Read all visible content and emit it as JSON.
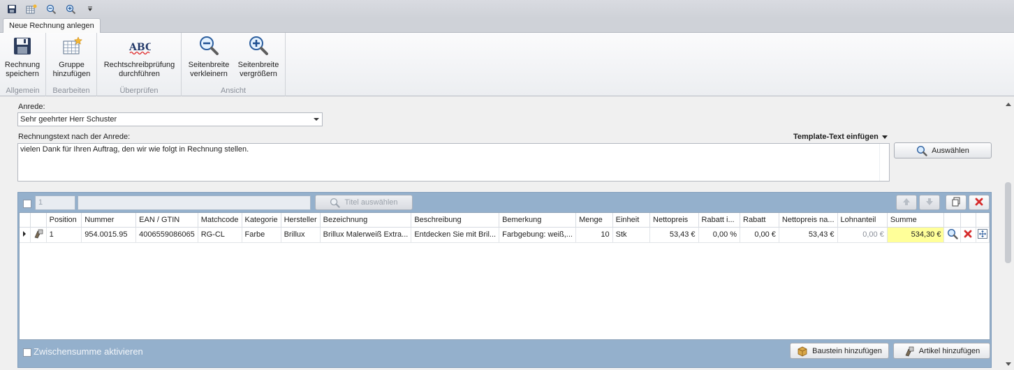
{
  "ribbon": {
    "tab": "Neue Rechnung anlegen",
    "groups": [
      {
        "label": "Allgemein",
        "buttons": [
          {
            "line1": "Rechnung",
            "line2": "speichern",
            "icon": "floppy-disk-icon"
          }
        ]
      },
      {
        "label": "Bearbeiten",
        "buttons": [
          {
            "line1": "Gruppe",
            "line2": "hinzufügen",
            "icon": "table-star-icon"
          }
        ]
      },
      {
        "label": "Überprüfen",
        "buttons": [
          {
            "line1": "Rechtschreibprüfung",
            "line2": "durchführen",
            "icon": "spellcheck-icon"
          }
        ]
      },
      {
        "label": "Ansicht",
        "buttons": [
          {
            "line1": "Seitenbreite",
            "line2": "verkleinern",
            "icon": "zoom-out-icon"
          },
          {
            "line1": "Seitenbreite",
            "line2": "vergrößern",
            "icon": "zoom-in-icon"
          }
        ]
      }
    ]
  },
  "form": {
    "salutation_label": "Anrede:",
    "salutation_value": "Sehr geehrter Herr Schuster",
    "text_label": "Rechnungstext nach der Anrede:",
    "template_link": "Template-Text einfügen",
    "text_value": "vielen Dank für Ihren Auftrag, den wir wie folgt in Rechnung stellen.",
    "select_button": "Auswählen"
  },
  "panel": {
    "position_input": "1",
    "title_button": "Titel auswählen",
    "subtotal_label": "Zwischensumme aktivieren",
    "add_block_button": "Baustein hinzufügen",
    "add_article_button": "Artikel hinzufügen"
  },
  "grid": {
    "columns": [
      "Position",
      "Nummer",
      "EAN / GTIN",
      "Matchcode",
      "Kategorie",
      "Hersteller",
      "Bezeichnung",
      "Beschreibung",
      "Bemerkung",
      "Menge",
      "Einheit",
      "Nettopreis",
      "Rabatt i...",
      "Rabatt",
      "Nettopreis na...",
      "Lohnanteil",
      "Summe"
    ],
    "rows": [
      {
        "position": "1",
        "nummer": "954.0015.95",
        "ean": "4006559086065",
        "matchcode": "RG-CL",
        "kategorie": "Farbe",
        "hersteller": "Brillux",
        "bezeichnung": "Brillux Malerweiß Extra...",
        "beschreibung": "Entdecken Sie mit Bril...",
        "bemerkung": "Farbgebung: weiß,...",
        "menge": "10",
        "einheit": "Stk",
        "nettopreis": "53,43 €",
        "rabatt_prozent": "0,00 %",
        "rabatt": "0,00 €",
        "nettopreis_nach": "53,43 €",
        "lohnanteil": "0,00 €",
        "summe": "534,30 €"
      }
    ]
  },
  "colors": {
    "panel": "#94b0cc",
    "sum_highlight": "#ffff99",
    "delete_red": "#d62c2c"
  }
}
